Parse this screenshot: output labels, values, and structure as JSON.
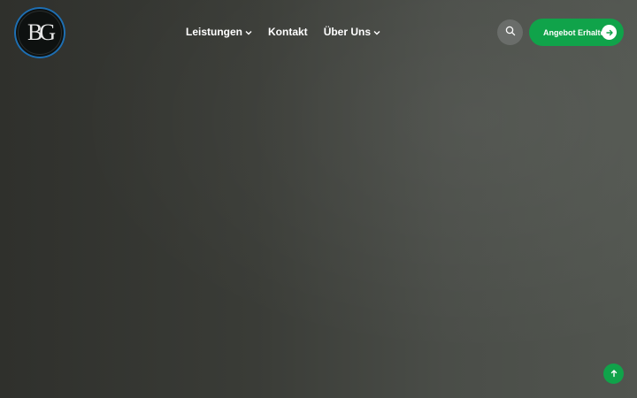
{
  "logo": {
    "text": "BG"
  },
  "nav": {
    "items": [
      {
        "label": "Leistungen",
        "has_dropdown": true
      },
      {
        "label": "Kontakt",
        "has_dropdown": false
      },
      {
        "label": "Über Uns",
        "has_dropdown": true
      }
    ]
  },
  "header": {
    "search_icon": "search-icon",
    "cta_label": "Angebot Erhalten!",
    "cta_icon": "arrow-right-icon"
  },
  "scroll_top": {
    "icon": "arrow-up-icon"
  },
  "colors": {
    "accent": "#10a34a",
    "logo_ring": "#1f6fb2",
    "search_bg": "#6a6d6a"
  }
}
